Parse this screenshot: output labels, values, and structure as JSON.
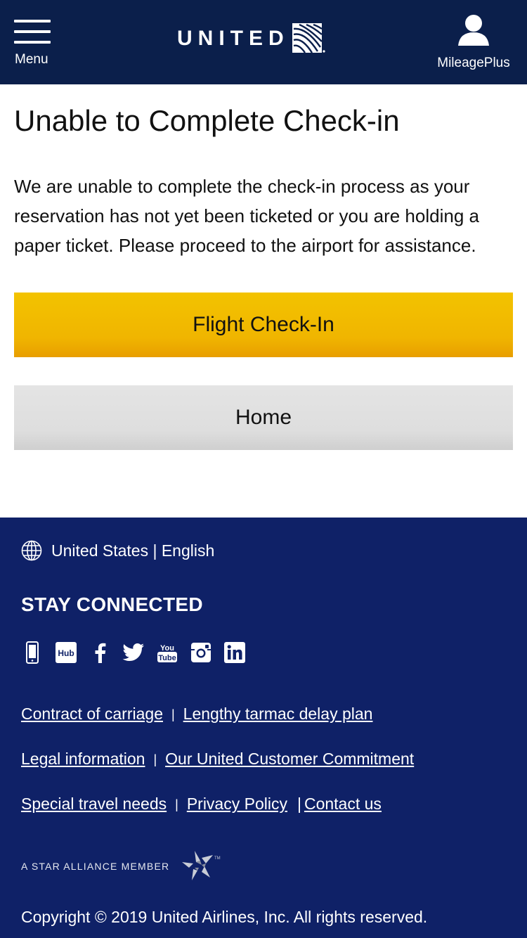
{
  "header": {
    "menu_label": "Menu",
    "logo_text": "UNITED",
    "mileageplus_label": "MileagePlus"
  },
  "main": {
    "title": "Unable to Complete Check-in",
    "message": "We are unable to complete the check-in process as your reservation has not yet been ticketed or you are holding a paper ticket. Please proceed to the airport for assistance.",
    "primary_button": "Flight Check-In",
    "secondary_button": "Home"
  },
  "footer": {
    "locale": "United States | English",
    "stay_connected": "STAY CONNECTED",
    "social_icons": [
      "mobile-app-icon",
      "hub-icon",
      "facebook-icon",
      "twitter-icon",
      "youtube-icon",
      "instagram-icon",
      "linkedin-icon"
    ],
    "links": {
      "contract": "Contract of carriage",
      "tarmac": "Lengthy tarmac delay plan",
      "legal": "Legal information",
      "commitment": "Our United Customer Commitment",
      "special": "Special travel needs",
      "privacy": "Privacy Policy",
      "contact": "Contact us"
    },
    "separator": "|",
    "alliance": "A STAR ALLIANCE MEMBER",
    "copyright": "Copyright © 2019 United Airlines, Inc. All rights reserved."
  },
  "colors": {
    "header_bg": "#0b1f4b",
    "footer_bg": "#0f2167",
    "primary_button": "#f0b500",
    "secondary_button": "#e0e0e0"
  }
}
